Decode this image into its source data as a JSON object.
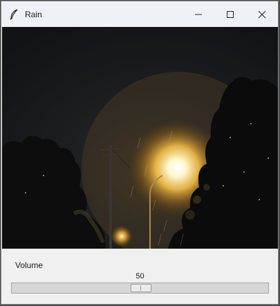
{
  "window": {
    "title": "Rain",
    "app_icon": "feather-icon",
    "controls": [
      "minimize-icon",
      "maximize-icon",
      "close-icon"
    ]
  },
  "image": {
    "description_icon": "night-rain-street-light-photo"
  },
  "volume": {
    "label": "Volume",
    "value": "50",
    "min": 0,
    "max": 100,
    "level": 50
  }
}
